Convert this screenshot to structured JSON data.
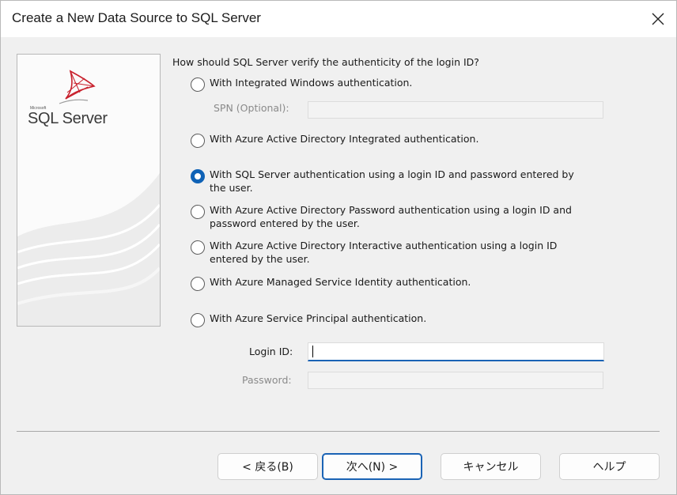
{
  "window": {
    "title": "Create a New Data Source to SQL Server"
  },
  "banner": {
    "logo_small": "Microsoft",
    "logo_text": "SQL Server"
  },
  "question": "How should SQL Server verify the authenticity of the login ID?",
  "options": [
    {
      "lines": [
        "With Integrated Windows authentication."
      ],
      "checked": false
    },
    {
      "lines": [
        "With Azure Active Directory Integrated authentication."
      ],
      "checked": false
    },
    {
      "lines": [
        "With SQL Server authentication using a login ID and password entered by",
        "the user."
      ],
      "checked": true
    },
    {
      "lines": [
        "With Azure Active Directory Password authentication using a login ID and",
        "password entered by the user."
      ],
      "checked": false
    },
    {
      "lines": [
        "With Azure Active Directory Interactive authentication using a login ID",
        "entered by the user."
      ],
      "checked": false
    },
    {
      "lines": [
        "With Azure Managed Service Identity authentication."
      ],
      "checked": false
    },
    {
      "lines": [
        "With Azure Service Principal authentication."
      ],
      "checked": false
    }
  ],
  "spn": {
    "label": "SPN (Optional):",
    "value": ""
  },
  "login": {
    "label": "Login ID:",
    "value": ""
  },
  "password": {
    "label": "Password:",
    "value": ""
  },
  "buttons": {
    "back": "< 戻る(B)",
    "next": "次へ(N) >",
    "cancel": "キャンセル",
    "help": "ヘルプ"
  }
}
